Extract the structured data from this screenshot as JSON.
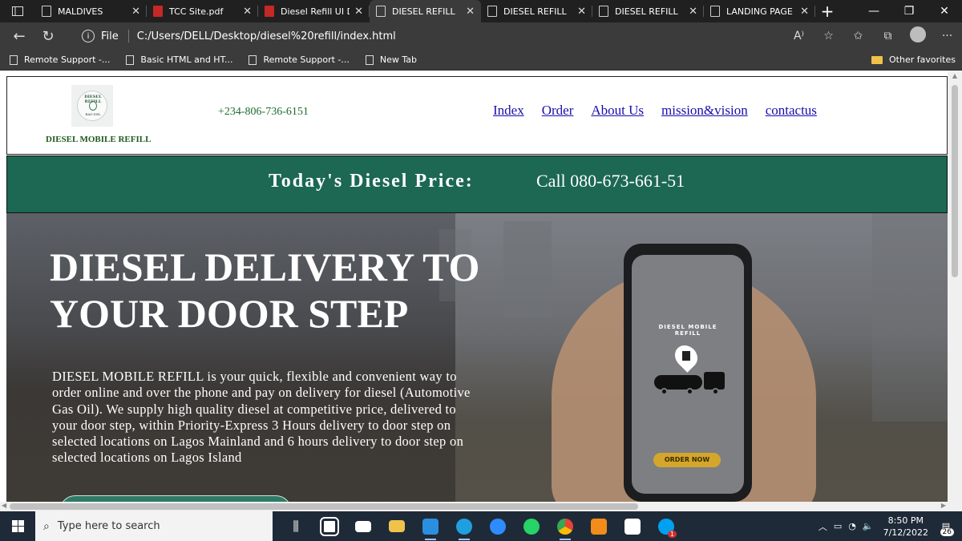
{
  "browser": {
    "tabs": [
      {
        "label": "MALDIVES",
        "icon": "page-icon",
        "active": false
      },
      {
        "label": "TCC Site.pdf",
        "icon": "pdf-icon",
        "active": false
      },
      {
        "label": "Diesel Refill UI De",
        "icon": "pdf-icon",
        "active": false
      },
      {
        "label": "DIESEL REFILL",
        "icon": "page-icon",
        "active": true
      },
      {
        "label": "DIESEL REFILL",
        "icon": "page-icon",
        "active": false
      },
      {
        "label": "DIESEL REFILL",
        "icon": "page-icon",
        "active": false
      },
      {
        "label": "LANDING PAGE",
        "icon": "page-icon",
        "active": false
      }
    ],
    "address": {
      "scheme_label": "File",
      "url": "C:/Users/DELL/Desktop/diesel%20refill/index.html"
    },
    "bookmarks": [
      {
        "label": "Remote Support -..."
      },
      {
        "label": "Basic HTML and HT..."
      },
      {
        "label": "Remote Support -..."
      },
      {
        "label": "New Tab"
      }
    ],
    "other_favorites": "Other favorites"
  },
  "site": {
    "logo": {
      "arc_text": "DIESEL REFILL",
      "sub_text": "RAG-DEL"
    },
    "brand": "DIESEL MOBILE REFILL",
    "phone": "+234-806-736-6151",
    "nav": [
      "Index",
      "Order",
      "About Us",
      "mission&vision",
      "contactus"
    ],
    "price_banner": {
      "title": "Today's Diesel Price:",
      "call": "Call 080-673-661-51"
    },
    "hero": {
      "title": "DIESEL DELIVERY TO YOUR DOOR STEP",
      "text": "DIESEL MOBILE REFILL is your quick, flexible and convenient way to order online and over the phone and pay on delivery for diesel (Automotive Gas Oil). We supply high quality diesel at competitive price, delivered to your door step, within Priority-Express 3 Hours delivery to door step on selected locations on Lagos Mainland and 6 hours delivery to door step on selected locations on Lagos Island",
      "phone_screen_label": "DIESEL MOBILE REFILL",
      "phone_button": "ORDER NOW"
    }
  },
  "taskbar": {
    "search_placeholder": "Type here to search",
    "apps": [
      "task-view-icon",
      "store-icon",
      "mail-icon",
      "file-explorer-icon",
      "vscode-icon",
      "edge-icon",
      "zoom-icon",
      "whatsapp-icon",
      "chrome-icon",
      "sublime-icon",
      "photos-icon",
      "skype-icon"
    ],
    "skype_badge": "1",
    "time": "8:50 PM",
    "date": "7/12/2022",
    "notification_count": "26",
    "colors": {
      "vscode": "#2b8fe0",
      "edge": "#1ea0e0",
      "zoom": "#2d8cff",
      "whatsapp": "#25d366",
      "chrome": "#e84335",
      "sublime": "#f28c1b",
      "skype": "#00a1f1"
    }
  }
}
